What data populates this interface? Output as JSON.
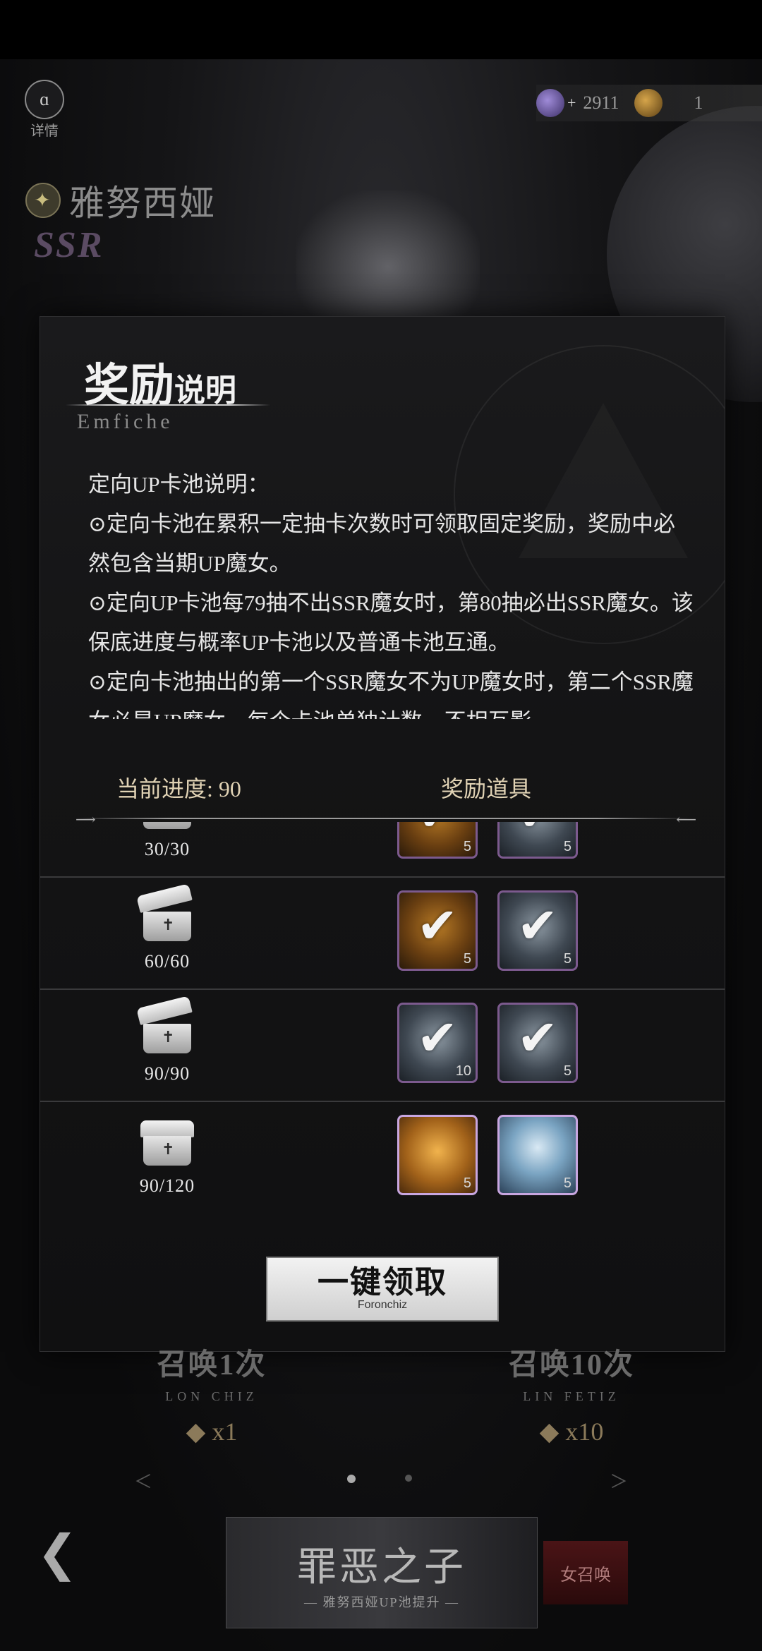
{
  "header": {
    "details_label": "详情",
    "gem_count": "2911",
    "ticket_count": "1",
    "character_name": "雅努西娅",
    "rarity": "SSR"
  },
  "modal": {
    "title_big": "奖励",
    "title_small": "说明",
    "subtitle": "Emfiche",
    "description": [
      "定向UP卡池说明：",
      "⊙定向卡池在累积一定抽卡次数时可领取固定奖励，奖励中必然包含当期UP魔女。",
      "⊙定向UP卡池每79抽不出SSR魔女时，第80抽必出SSR魔女。该保底进度与概率UP卡池以及普通卡池互通。",
      "⊙定向卡池抽出的第一个SSR魔女不为UP魔女时，第二个SSR魔女必是UP魔女。每个卡池单独计数，不相互影"
    ],
    "progress_label": "当前进度: 90",
    "reward_label": "奖励道具",
    "rows": [
      {
        "count": "30/30",
        "items": [
          {
            "type": "gold",
            "qty": "5"
          },
          {
            "type": "silver",
            "qty": "5"
          }
        ]
      },
      {
        "count": "60/60",
        "items": [
          {
            "type": "gold",
            "qty": "5"
          },
          {
            "type": "silver",
            "qty": "5"
          }
        ]
      },
      {
        "count": "90/90",
        "items": [
          {
            "type": "silver",
            "qty": "10"
          },
          {
            "type": "silver",
            "qty": "5"
          }
        ]
      },
      {
        "count": "90/120",
        "items": [
          {
            "type": "card",
            "qty": "5"
          },
          {
            "type": "portrait",
            "qty": "5"
          }
        ]
      }
    ],
    "claim_label": "一键领取",
    "claim_sub": "Foronchiz"
  },
  "bottom": {
    "summon1_title": "召唤1次",
    "summon1_sub": "LON CHIZ",
    "summon1_cost": "x1",
    "summon10_title": "召唤10次",
    "summon10_sub": "LIN FETIZ",
    "summon10_cost": "x10",
    "banner_title": "罪恶之子",
    "banner_sub": "— 雅努西娅UP池提升 —",
    "banner2_label": "女召唤"
  },
  "colors": {
    "item_border": "#7c5a8e",
    "item_border_active": "#c8a6e0",
    "progress_text": "#e0d2b4"
  }
}
